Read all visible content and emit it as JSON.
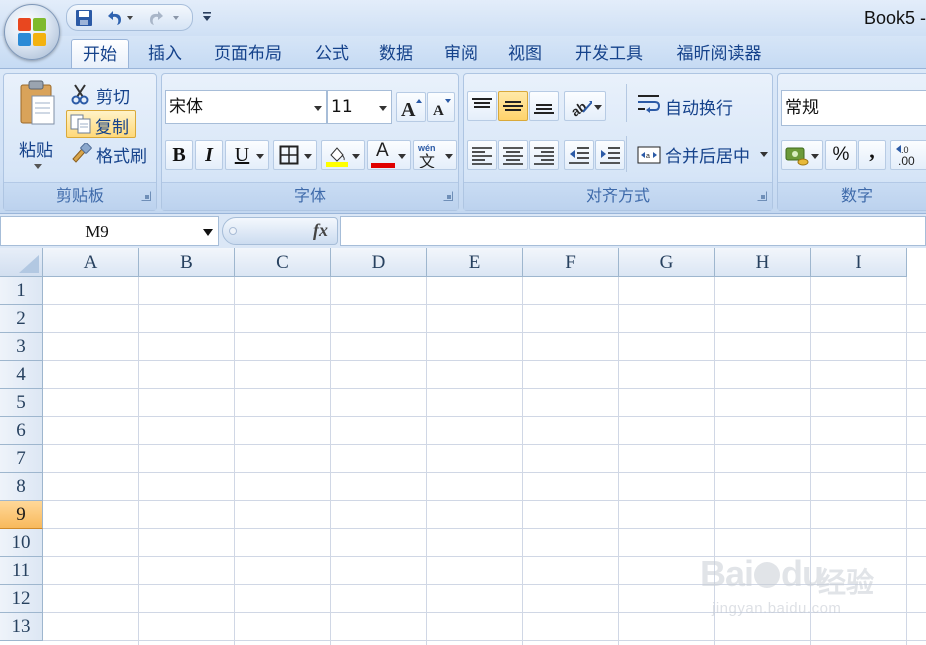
{
  "window": {
    "title": "Book5 -"
  },
  "tabs": [
    "开始",
    "插入",
    "页面布局",
    "公式",
    "数据",
    "审阅",
    "视图",
    "开发工具",
    "福昕阅读器"
  ],
  "active_tab": "开始",
  "ribbon": {
    "clipboard": {
      "label": "剪贴板",
      "paste": "粘贴",
      "cut": "剪切",
      "copy": "复制",
      "format_painter": "格式刷"
    },
    "font": {
      "label": "字体",
      "font_name": "宋体",
      "font_size": "11",
      "bold": "B",
      "italic": "I",
      "underline": "U",
      "font_color_glyph": "A",
      "phonetic_glyph": "wén\n文",
      "highlight_color": "#ffff00",
      "font_color": "#e00000"
    },
    "alignment": {
      "label": "对齐方式",
      "wrap_text": "自动换行",
      "merge_center": "合并后居中"
    },
    "number": {
      "label": "数字",
      "format": "常规",
      "percent": "%",
      "comma": ",",
      "increase_decimal": ".00"
    }
  },
  "formula_bar": {
    "name_box": "M9",
    "fx": "fx",
    "formula": ""
  },
  "grid": {
    "columns": [
      "A",
      "B",
      "C",
      "D",
      "E",
      "F",
      "G",
      "H",
      "I"
    ],
    "rows": [
      "1",
      "2",
      "3",
      "4",
      "5",
      "6",
      "7",
      "8",
      "9",
      "10",
      "11",
      "12",
      "13"
    ],
    "active_row": "9"
  },
  "watermark": {
    "brand": "Bai",
    "brand2": "du",
    "product": "经验",
    "url": "jingyan.baidu.com"
  }
}
